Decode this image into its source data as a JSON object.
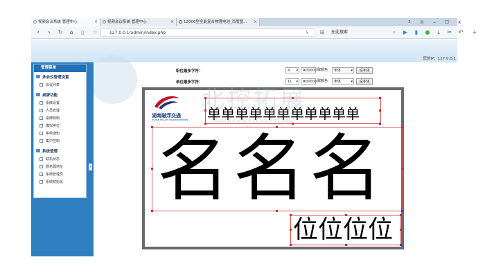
{
  "browser": {
    "tabs": [
      {
        "label": "视频会议系统 管理中心"
      },
      {
        "label": "视频会议系统 管理中心"
      },
      {
        "label": "12000型全能复合物锂电池_百度图..."
      }
    ],
    "url": "127.0.0.1/admin/index.php",
    "search_placeholder": "在此搜索",
    "tab_count": "3"
  },
  "header": {
    "user_ip": "您的IP：127.0.0.1"
  },
  "menu": {
    "title": "管理菜单",
    "groups": [
      {
        "label": "多会议管理设置",
        "items": [
          "会议列表"
        ]
      },
      {
        "label": "桌牌功能",
        "items": [
          "桌牌设置",
          "人员管理",
          "桌牌特制",
          "模拟排位",
          "系统通知",
          "集中控制"
        ]
      },
      {
        "label": "系统管理",
        "items": [
          "联机状态",
          "服务器地址",
          "系统管理员",
          "系统初始化"
        ]
      }
    ]
  },
  "controls": {
    "row1": {
      "label": "职位最多字符：",
      "size": "4",
      "color": "#00000",
      "color_label": "取颜色",
      "font": "宋体",
      "button": "设字体"
    },
    "row2": {
      "label": "单位最多字符：",
      "size": "11",
      "color": "#00000",
      "color_label": "取颜色",
      "font": "宋体",
      "button": "设字体"
    }
  },
  "board": {
    "logo_cn": "湖南磁浮交通",
    "logo_en": "HUNAN MAGLEV TRANSPORTATION",
    "unit_text": "单单单单单单单单单单单",
    "name_text": "名名名",
    "position_text": "位位位位"
  },
  "watermark": {
    "cn": "北控拓展",
    "en": "BeiKongTuoZhan"
  },
  "colors": {
    "menu_blue": "#2f7fc0",
    "board_border": "#6b6b6b",
    "selection_red": "#d9534f"
  }
}
